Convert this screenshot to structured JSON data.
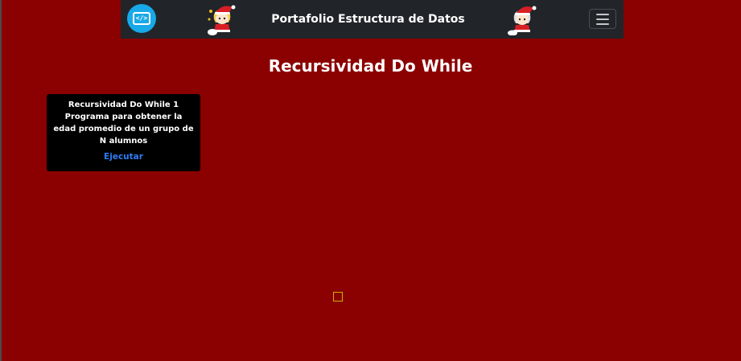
{
  "navbar": {
    "title": "Portafolio Estructura de Datos",
    "logo_icon": "code-monitor-icon",
    "logo_glyph": "</>",
    "menu_icon": "hamburger-menu-icon",
    "mascot_icon": "santa-mascot-icon"
  },
  "page": {
    "heading": "Recursividad Do While"
  },
  "cards": [
    {
      "title_line": "Recursividad Do While 1",
      "description": "Programa para obtener la edad promedio de un grupo de N alumnos",
      "action_label": "Ejecutar"
    }
  ],
  "colors": {
    "background": "#8b0000",
    "navbar": "#212529",
    "card": "#000000",
    "link": "#2f7cf6",
    "logo": "#17a9e8"
  }
}
